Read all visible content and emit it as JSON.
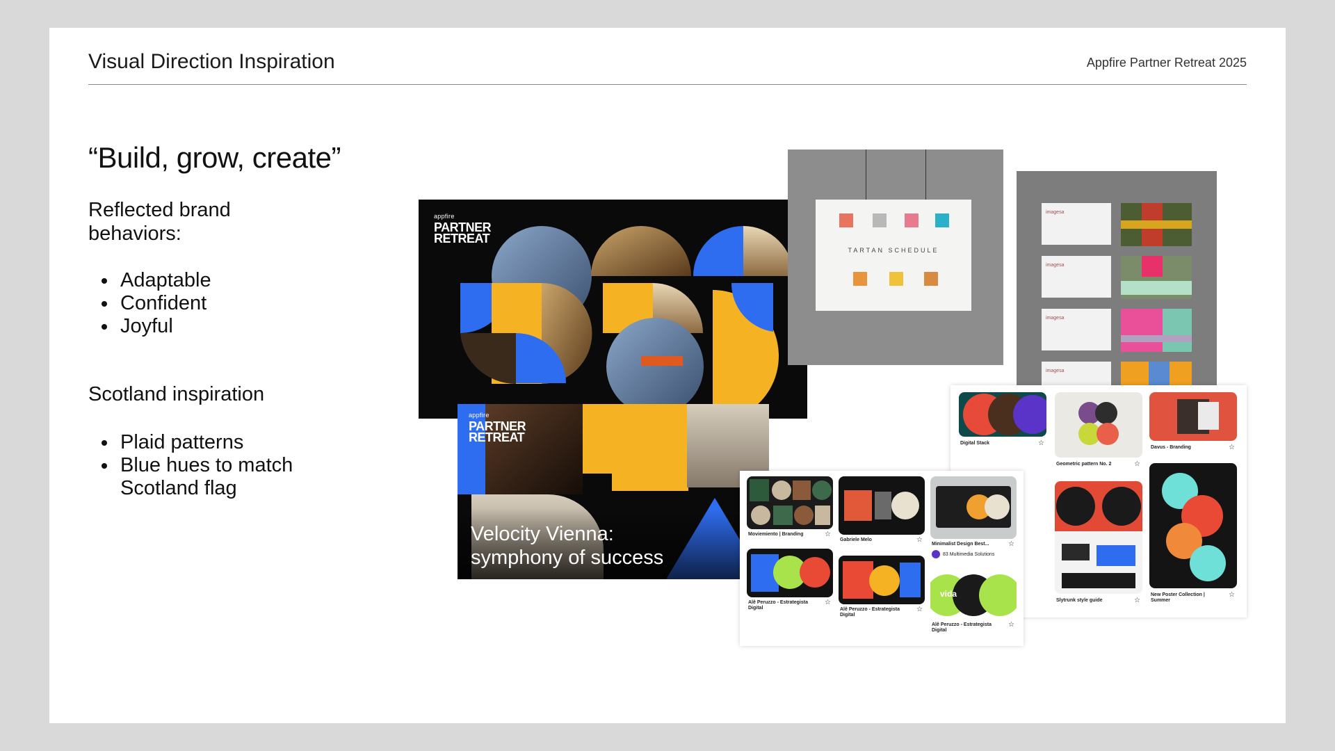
{
  "header": {
    "title": "Visual Direction Inspiration",
    "event": "Appfire Partner Retreat 2025"
  },
  "content": {
    "quote": "“Build, grow, create”",
    "behaviors_heading_1": "Reflected brand",
    "behaviors_heading_2": "behaviors:",
    "behaviors": [
      "Adaptable",
      "Confident",
      "Joyful"
    ],
    "scotland_heading": "Scotland inspiration",
    "scotland_items": [
      "Plaid patterns",
      "Blue hues to match",
      "Scotland flag"
    ]
  },
  "collage": {
    "logo_small": "appfire",
    "logo_line1": "PARTNER",
    "logo_line2": "RETREAT",
    "poster2_line1": "Velocity Vienna:",
    "poster2_line2": "symphony of success",
    "mockup_title": "TARTAN SCHEDULE",
    "brand_word": "imagesa",
    "pins_right": [
      "Digital Stack",
      "Geometric pattern No. 2",
      "Davus - Branding",
      "Slytrunk style guide",
      "New Poster Collection |",
      "Summer"
    ],
    "pins_left": [
      "Moviemiento | Branding",
      "Gabriele Melo",
      "Minimalist Design Best...",
      "83 Multimedia Solutions",
      "Alê Peruzzo - Estrategista",
      "Digital",
      "vida"
    ],
    "colors": {
      "blue": "#2f6df0",
      "yellow": "#f5b323",
      "black": "#0a0a0a",
      "red": "#ea4a35",
      "green": "#a9e34b"
    }
  }
}
